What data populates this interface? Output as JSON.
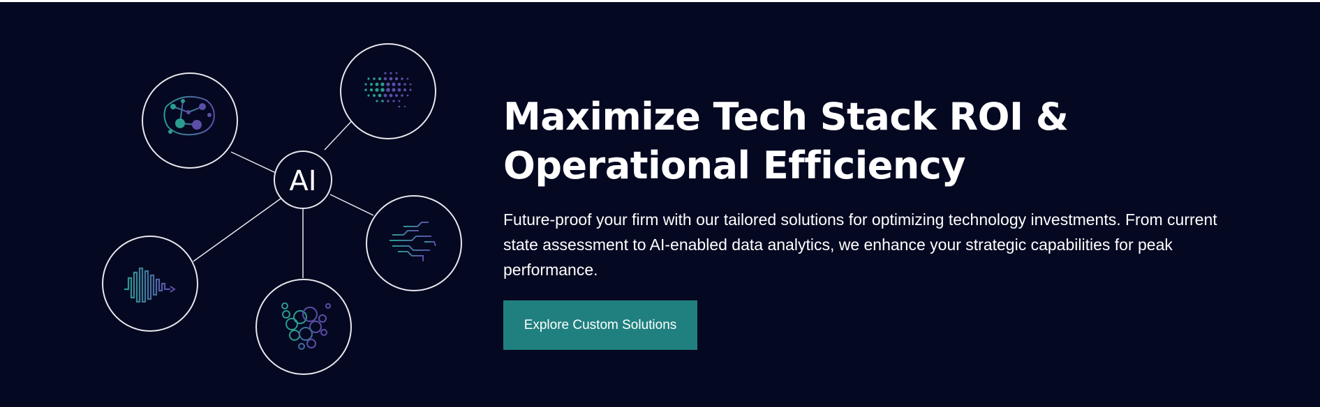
{
  "hero": {
    "headline_line1": "Maximize Tech Stack ROI &",
    "headline_line2": "Operational Efficiency",
    "subtext": "Future-proof your firm with our tailored solutions for optimizing technology investments. From current state assessment to AI-enabled data analytics, we enhance your strategic capabilities for peak performance.",
    "cta_label": "Explore Custom Solutions"
  },
  "diagram": {
    "hub_label": "AI",
    "nodes": [
      {
        "icon": "brain-network-icon"
      },
      {
        "icon": "dot-matrix-brain-icon"
      },
      {
        "icon": "circuit-brain-icon"
      },
      {
        "icon": "bubble-cluster-icon"
      },
      {
        "icon": "waveform-icon"
      }
    ]
  },
  "colors": {
    "background": "#050821",
    "button": "#20807f",
    "teal": "#2a9d8f",
    "purple": "#5a4fa8",
    "line": "#e8e8ee"
  }
}
